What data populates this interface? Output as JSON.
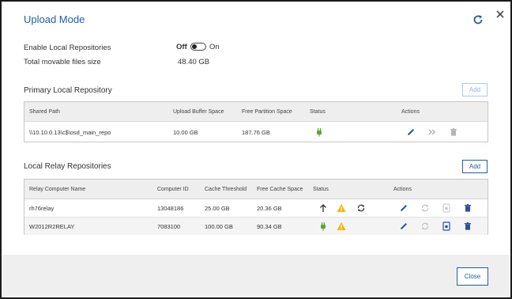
{
  "dialog": {
    "title": "Upload Mode",
    "enable_label": "Enable Local Repositories",
    "toggle_off": "Off",
    "toggle_on": "On",
    "total_label": "Total movable files size",
    "total_value": "48.40 GB",
    "close_label": "Close"
  },
  "primary": {
    "title": "Primary Local Repository",
    "add_label": "Add",
    "headers": [
      "Shared Path",
      "Upload Buffer Space",
      "Free Partition Space",
      "Status",
      "Actions"
    ],
    "row": {
      "path": "\\\\10.10.0.13\\c$\\osd_main_repo",
      "buffer": "10.00 GB",
      "free": "187.76 GB"
    }
  },
  "relay": {
    "title": "Local Relay Repositories",
    "add_label": "Add",
    "headers": [
      "Relay Computer Name",
      "Computer ID",
      "Cache Threshold",
      "Free Cache Space",
      "Status",
      "Actions"
    ],
    "rows": [
      {
        "name": "rh76relay",
        "id": "13048186",
        "threshold": "25.00 GB",
        "free": "20.36 GB"
      },
      {
        "name": "W2012R2RELAY",
        "id": "7083100",
        "threshold": "100.00 GB",
        "free": "90.34 GB"
      }
    ]
  },
  "colors": {
    "accent": "#1f5ea8",
    "status_green": "#5aa832",
    "warning_yellow": "#f2b705",
    "delete_blue": "#2e4f9a"
  }
}
